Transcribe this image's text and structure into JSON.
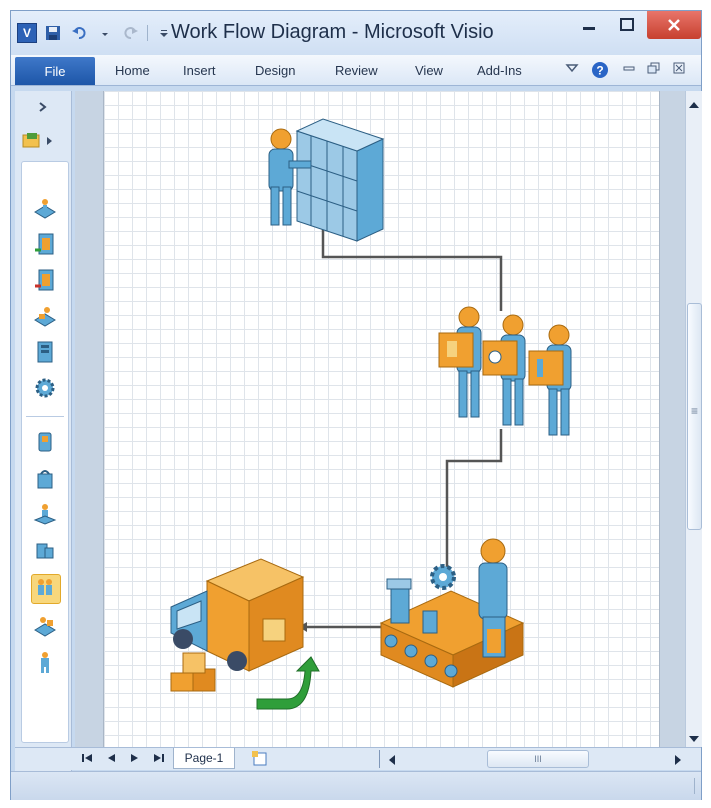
{
  "window": {
    "title": "Work Flow Diagram - Microsoft Visio",
    "qat_app_icon": "V",
    "controls": [
      "minimize-icon",
      "maximize-icon",
      "close-icon"
    ]
  },
  "ribbon": {
    "file_label": "File",
    "tabs": [
      {
        "label": "Home"
      },
      {
        "label": "Insert"
      },
      {
        "label": "Design"
      },
      {
        "label": "Review"
      },
      {
        "label": "View"
      },
      {
        "label": "Add-Ins"
      }
    ]
  },
  "stencil": {
    "expand_icon": "chevron-right-icon",
    "shapes": [
      "shipping-desk-icon",
      "receiving-door-icon",
      "return-door-icon",
      "workstation-icon",
      "server-icon",
      "gear-machine-icon",
      "kiosk-icon",
      "bag-icon",
      "person-at-desk-icon",
      "package-icon",
      "worker-selected-icon",
      "loader-icon",
      "person-icon"
    ],
    "selected_index": 10
  },
  "diagram": {
    "nodes": [
      "file-cabinet-clerk",
      "packing-team",
      "assembly-line-worker",
      "delivery-truck"
    ],
    "connector_color": "#555555",
    "accent_orange": "#f0a030",
    "accent_blue": "#5da9d6",
    "accent_green": "#2f9e3a"
  },
  "page_nav": {
    "page_label": "Page-1"
  },
  "scrollbars": {
    "vertical_grip": "≡",
    "horizontal_grip": "III"
  }
}
